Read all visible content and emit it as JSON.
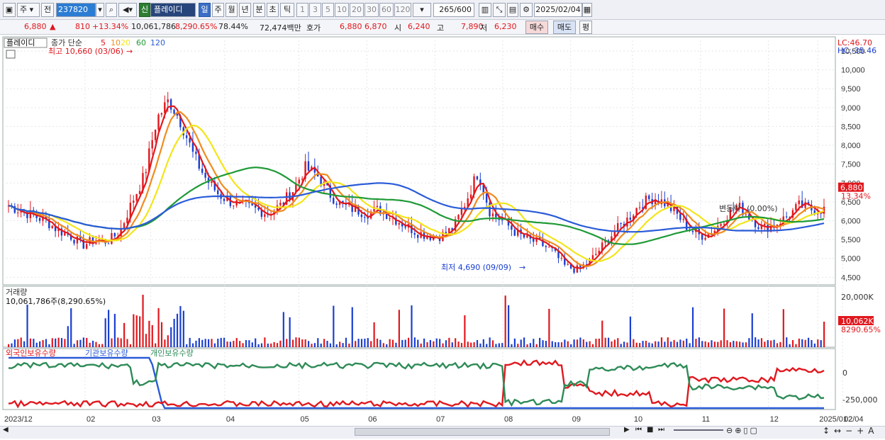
{
  "toolbar": {
    "market": "주",
    "prefix": "전",
    "code": "237820",
    "stock_name": "플레이디",
    "new_badge": "신",
    "periods": [
      "일",
      "주",
      "월",
      "년",
      "분",
      "초",
      "틱"
    ],
    "active_period": "일",
    "minutes": [
      "1",
      "3",
      "5",
      "10",
      "20",
      "30",
      "60",
      "120"
    ],
    "count": "265",
    "count_total": "/600",
    "date": "2025/02/04"
  },
  "quote": {
    "price": "6,880",
    "arrow": "▲",
    "change": "810",
    "change_pct": "+13.34%",
    "volume": "10,061,786",
    "vol_pct": "8,290.65%",
    "turnover": "78.44%",
    "amount": "72,474백만",
    "hoga_label": "호가",
    "ask": "6,880",
    "bid": "6,870",
    "open_label": "시",
    "open": "6,240",
    "high_label": "고",
    "high": "7,890",
    "low_label": "저",
    "low": "6,230",
    "buy_btn": "매수",
    "sell_btn": "매도",
    "pyeong_btn": "평"
  },
  "price_panel": {
    "name": "플레이디",
    "legend_label": "종가 단순",
    "ma_periods": [
      "5",
      "10",
      "20",
      "60",
      "120"
    ],
    "ma_colors": [
      "#e0181e",
      "#f08c1e",
      "#f3e51a",
      "#1e9a36",
      "#2a5bd8"
    ],
    "high_note": "최고 10,660 (03/06)",
    "low_note": "최저 4,690 (09/09)",
    "mid_note": "(0.00%)",
    "mid_note_prefix": "변동락",
    "lc": "LC:46.70",
    "hc": "HC:-35.46",
    "y_ticks": [
      "10,500",
      "10,000",
      "9,500",
      "9,000",
      "8,500",
      "8,000",
      "7,500",
      "7,000",
      "6,500",
      "6,000",
      "5,500",
      "5,000",
      "4,500"
    ],
    "last_price": "6,880",
    "last_pct": "13.34%"
  },
  "volume_panel": {
    "title": "거래량",
    "info": "10,061,786주(8,290.65%)",
    "y_tick": "20,000K",
    "last": "10,062K",
    "last_pct": "8290.65%"
  },
  "holding_panel": {
    "series": [
      "외국인보유수량",
      "기관보유수량",
      "개인보유수량"
    ],
    "colors": [
      "#e0181e",
      "#2a5bd8",
      "#2e8b57"
    ],
    "y_ticks": [
      "0",
      "-250,000"
    ]
  },
  "x_axis": [
    "2023/12",
    "02",
    "03",
    "04",
    "05",
    "06",
    "07",
    "08",
    "09",
    "10",
    "11",
    "12",
    "2025/01",
    "02",
    "02/04"
  ],
  "chart_data": {
    "type": "line",
    "price_range": [
      4300,
      10800
    ],
    "close_points": [
      [
        0,
        6400
      ],
      [
        1.5,
        6200
      ],
      [
        3,
        6000
      ],
      [
        4,
        5750
      ],
      [
        5,
        5600
      ],
      [
        6,
        5350
      ],
      [
        7,
        5500
      ],
      [
        8,
        5450
      ],
      [
        9,
        5700
      ],
      [
        10,
        6500
      ],
      [
        11,
        7200
      ],
      [
        12,
        8700
      ],
      [
        13,
        9200
      ],
      [
        14,
        8600
      ],
      [
        15,
        7700
      ],
      [
        16,
        7100
      ],
      [
        17,
        6700
      ],
      [
        18,
        6500
      ],
      [
        19,
        6400
      ],
      [
        20,
        6300
      ],
      [
        21,
        6200
      ],
      [
        22,
        6400
      ],
      [
        23,
        6800
      ],
      [
        24,
        7400
      ],
      [
        25,
        7200
      ],
      [
        26,
        6700
      ],
      [
        27,
        6400
      ],
      [
        28,
        6300
      ],
      [
        29,
        6200
      ],
      [
        30,
        6300
      ],
      [
        31,
        6100
      ],
      [
        32,
        5900
      ],
      [
        33,
        5700
      ],
      [
        34,
        5600
      ],
      [
        35,
        5600
      ],
      [
        36,
        5800
      ],
      [
        37,
        6500
      ],
      [
        38,
        7300
      ],
      [
        39,
        6200
      ],
      [
        40,
        6000
      ],
      [
        41,
        5700
      ],
      [
        42,
        5500
      ],
      [
        43,
        5400
      ],
      [
        44,
        5200
      ],
      [
        45,
        4800
      ],
      [
        46,
        4700
      ],
      [
        47,
        4900
      ],
      [
        48,
        5300
      ],
      [
        49,
        5700
      ],
      [
        50,
        6000
      ],
      [
        51,
        6400
      ],
      [
        52,
        6600
      ],
      [
        53,
        6500
      ],
      [
        54,
        6200
      ],
      [
        55,
        5800
      ],
      [
        56,
        5600
      ],
      [
        57,
        5700
      ],
      [
        58,
        6100
      ],
      [
        59,
        6400
      ],
      [
        60,
        6100
      ],
      [
        61,
        5800
      ],
      [
        62,
        5900
      ],
      [
        63,
        6100
      ],
      [
        64,
        6400
      ],
      [
        65,
        6300
      ],
      [
        66,
        6300
      ]
    ],
    "volume_note": "bars in thousands of shares",
    "holding_range": [
      -280000,
      60000
    ]
  }
}
